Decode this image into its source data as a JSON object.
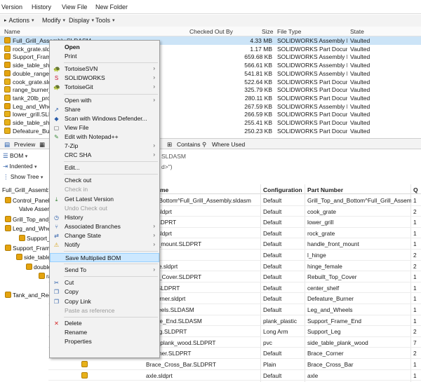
{
  "menubar": {
    "items": [
      "Version",
      "History",
      "View File",
      "New Folder"
    ]
  },
  "toolbar": {
    "actions": "Actions",
    "modify": "Modify",
    "display": "Display",
    "tools": "Tools"
  },
  "top_table": {
    "columns": {
      "name": "Name",
      "checked_out_by": "Checked Out By",
      "size": "Size",
      "file_type": "File Type",
      "state": "State"
    },
    "rows": [
      {
        "name": "Full_Grill_Assembly.SLDASM",
        "size": "4.33 MB",
        "type": "SOLIDWORKS Assembly Do...",
        "state": "Vaulted"
      },
      {
        "name": "rock_grate.sldprt",
        "size": "1.17 MB",
        "type": "SOLIDWORKS Part Docume",
        "state": "Vaulted"
      },
      {
        "name": "Support_Frame_",
        "size": "659.68 KB",
        "type": "SOLIDWORKS Assembly Do...",
        "state": "Vaulted"
      },
      {
        "name": "side_table_shelf",
        "size": "566.61 KB",
        "type": "SOLIDWORKS Assembly Do...",
        "state": "Vaulted"
      },
      {
        "name": "double_range_b",
        "size": "541.81 KB",
        "type": "SOLIDWORKS Assembly Do...",
        "state": "Vaulted"
      },
      {
        "name": "cook_grate.sldp",
        "size": "522.64 KB",
        "type": "SOLIDWORKS Part Docume",
        "state": "Vaulted"
      },
      {
        "name": "range_burner_in",
        "size": "325.79 KB",
        "type": "SOLIDWORKS Part Docume",
        "state": "Vaulted"
      },
      {
        "name": "tank_20lb_propa",
        "size": "280.11 KB",
        "type": "SOLIDWORKS Part Docume",
        "state": "Vaulted"
      },
      {
        "name": "Leg_and_Wheels",
        "size": "267.59 KB",
        "type": "SOLIDWORKS Assembly Do...",
        "state": "Vaulted"
      },
      {
        "name": "lower_grill.SLDP",
        "size": "266.59 KB",
        "type": "SOLIDWORKS Part Docume",
        "state": "Vaulted"
      },
      {
        "name": "side_table_shelf",
        "size": "255.41 KB",
        "type": "SOLIDWORKS Part Docume",
        "state": "Vaulted"
      },
      {
        "name": "Defeature_Burne",
        "size": "250.23 KB",
        "type": "SOLIDWORKS Part Docume",
        "state": "Vaulted"
      }
    ]
  },
  "tabs": {
    "preview": "Preview",
    "contains": "Contains",
    "where_used": "Where Used"
  },
  "bom_bar": {
    "bom": "BOM",
    "indented": "Indented",
    "show_tree": "Show Tree",
    "file_label": "SLDASM",
    "config_hint": "d>\")"
  },
  "tree": [
    "Full_Grill_Assembly.SL",
    "Control_Panel.SLD",
    "Valve Assembly",
    "Grill_Top_and_Bot",
    "Leg_and_Wheels.",
    "Support_Frame",
    "Support_Frame_E",
    "side_table_sh",
    "double_ra",
    "range",
    "Tank_and_Regula"
  ],
  "grid": {
    "columns": {
      "name": "me",
      "configuration": "Configuration",
      "part_number": "Part Number",
      "qty": "Q"
    },
    "rows": [
      {
        "name": "and_Bottom^Full_Grill_Assembly.sldasm",
        "config": "Default",
        "part": "Grill_Top_and_Bottom^Full_Grill_Assembly",
        "qty": "1"
      },
      {
        "name": "rate.sldprt",
        "config": "Default",
        "part": "cook_grate",
        "qty": "2"
      },
      {
        "name": "rill.SLDPRT",
        "config": "Default",
        "part": "lower_grill",
        "qty": "1"
      },
      {
        "name": "rate.sldprt",
        "config": "Default",
        "part": "rock_grate",
        "qty": "1"
      },
      {
        "name": "front_mount.SLDPRT",
        "config": "Default",
        "part": "handle_front_mount",
        "qty": "1"
      },
      {
        "name": "PRT",
        "config": "Default",
        "part": "l_hinge",
        "qty": "2"
      },
      {
        "name": "emale.sldprt",
        "config": "Default",
        "part": "hinge_female",
        "qty": "2"
      },
      {
        "name": "_Top_Cover.SLDPRT",
        "config": "Default",
        "part": "Rebuilt_Top_Cover",
        "qty": "1"
      },
      {
        "name": "helf.SLDPRT",
        "config": "Default",
        "part": "center_shelf",
        "qty": "1"
      },
      {
        "name": "e_Burner.sldprt",
        "config": "Default",
        "part": "Defeature_Burner",
        "qty": "1"
      },
      {
        "name": "_Wheels.SLDASM",
        "config": "Default",
        "part": "Leg_and_Wheels",
        "qty": "1"
      },
      {
        "name": "Frame_End.SLDASM",
        "config": "plank_plastic",
        "part": "Support_Frame_End",
        "qty": "1"
      },
      {
        "name": "rt_Leg.SLDPRT",
        "config": "Long Arm",
        "part": "Support_Leg",
        "qty": "2"
      },
      {
        "name": "able_plank_wood.SLDPRT",
        "config": "pvc",
        "part": "side_table_plank_wood",
        "qty": "7"
      },
      {
        "name": "_Corner.SLDPRT",
        "config": "Default",
        "part": "Brace_Corner",
        "qty": "2"
      },
      {
        "name": "Brace_Cross_Bar.SLDPRT",
        "config": "Plain",
        "part": "Brace_Cross_Bar",
        "qty": "1"
      },
      {
        "name": "axle.sldprt",
        "config": "Default",
        "part": "axle",
        "qty": "1"
      }
    ]
  },
  "context_menu": {
    "items": [
      {
        "label": "Open",
        "bold": true
      },
      {
        "label": "Print"
      },
      {
        "label": "TortoiseSVN",
        "sub": true,
        "icon": "tortoise-icon"
      },
      {
        "label": "SOLIDWORKS",
        "sub": true,
        "icon": "solidworks-icon"
      },
      {
        "label": "TortoiseGit",
        "sub": true,
        "icon": "tortoise-icon"
      },
      {
        "label": "Open with",
        "sub": true
      },
      {
        "label": "Share",
        "icon": "share-icon"
      },
      {
        "label": "Scan with Windows Defender...",
        "icon": "defender-icon"
      },
      {
        "label": "View File",
        "icon": "view-icon"
      },
      {
        "label": "Edit with Notepad++",
        "icon": "notepad-icon"
      },
      {
        "label": "7-Zip",
        "sub": true
      },
      {
        "label": "CRC SHA",
        "sub": true
      },
      {
        "label": "Edit..."
      },
      {
        "label": "Check out"
      },
      {
        "label": "Check in",
        "disabled": true
      },
      {
        "label": "Get Latest Version",
        "icon": "get-latest-icon"
      },
      {
        "label": "Undo Check out",
        "disabled": true
      },
      {
        "label": "History",
        "icon": "history-icon"
      },
      {
        "label": "Associated Branches",
        "sub": true,
        "icon": "branch-icon"
      },
      {
        "label": "Change State",
        "sub": true,
        "icon": "state-icon"
      },
      {
        "label": "Notify",
        "sub": true,
        "icon": "notify-icon"
      },
      {
        "label": "Save Multiplied BOM",
        "highlight": true
      },
      {
        "label": "Send To",
        "sub": true
      },
      {
        "label": "Cut",
        "icon": "cut-icon"
      },
      {
        "label": "Copy",
        "icon": "copy-icon"
      },
      {
        "label": "Copy Link",
        "icon": "copy-link-icon"
      },
      {
        "label": "Paste as reference",
        "disabled": true
      },
      {
        "label": "Delete",
        "icon": "delete-icon"
      },
      {
        "label": "Rename"
      },
      {
        "label": "Properties"
      }
    ]
  }
}
